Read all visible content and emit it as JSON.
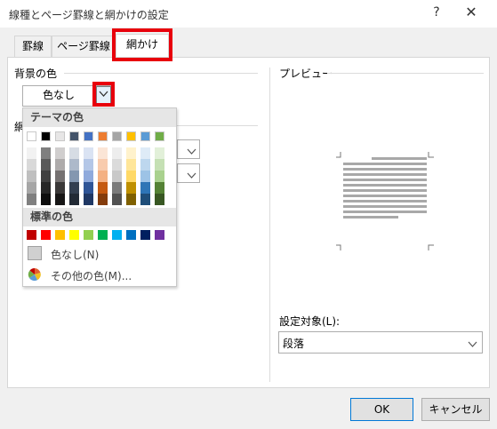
{
  "window": {
    "title": "線種とページ罫線と網かけの設定",
    "help": "?",
    "close": "✕"
  },
  "tabs": [
    {
      "label": "罫線"
    },
    {
      "label": "ページ罫線"
    },
    {
      "label": "網かけ"
    }
  ],
  "shading": {
    "background_label": "背景の色",
    "selected_color": "色なし",
    "pattern_label_partial": "網"
  },
  "color_picker": {
    "theme_header": "テーマの色",
    "standard_header": "標準の色",
    "no_color": "色なし(N)",
    "more_colors": "その他の色(M)...",
    "theme_top_row": [
      "#ffffff",
      "#000000",
      "#e7e6e6",
      "#44546a",
      "#4472c4",
      "#ed7d31",
      "#a5a5a5",
      "#ffc000",
      "#5b9bd5",
      "#70ad47"
    ],
    "theme_shades": [
      [
        "#f2f2f2",
        "#7f7f7f",
        "#d0cece",
        "#d6dce4",
        "#dae3f3",
        "#fbe5d6",
        "#ededed",
        "#fff2cc",
        "#deebf7",
        "#e2f0d9"
      ],
      [
        "#d9d9d9",
        "#595959",
        "#aeabab",
        "#adb9ca",
        "#b4c7e7",
        "#f8cbad",
        "#dbdbdb",
        "#ffe699",
        "#bdd7ee",
        "#c5e0b4"
      ],
      [
        "#bfbfbf",
        "#3f3f3f",
        "#757171",
        "#8497b0",
        "#8faadc",
        "#f4b183",
        "#c9c9c9",
        "#ffd966",
        "#9dc3e6",
        "#a9d18e"
      ],
      [
        "#a6a6a6",
        "#262626",
        "#3a3838",
        "#333f50",
        "#2f5597",
        "#c55a11",
        "#7b7b7b",
        "#bf9000",
        "#2e75b6",
        "#548235"
      ],
      [
        "#7f7f7f",
        "#0d0d0d",
        "#171616",
        "#222a35",
        "#203864",
        "#843c0c",
        "#525252",
        "#7f6000",
        "#1f4e79",
        "#385723"
      ]
    ],
    "standard_colors": [
      "#c00000",
      "#ff0000",
      "#ffc000",
      "#ffff00",
      "#92d050",
      "#00b050",
      "#00b0f0",
      "#0070c0",
      "#002060",
      "#7030a0"
    ]
  },
  "preview": {
    "label": "プレビュー",
    "apply_label": "設定対象(L):",
    "apply_value": "段落"
  },
  "buttons": {
    "ok": "OK",
    "cancel": "キャンセル"
  }
}
